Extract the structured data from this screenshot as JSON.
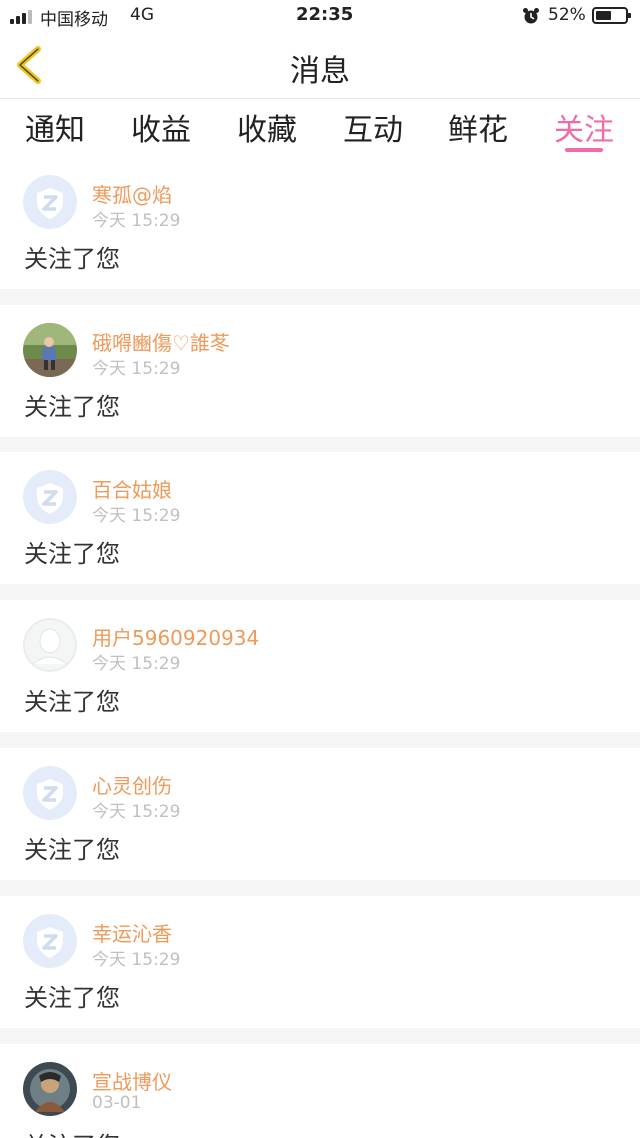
{
  "status_bar": {
    "carrier": "中国移动",
    "network": "4G",
    "time": "22:35",
    "battery_text": "52%",
    "battery_level": 0.52
  },
  "nav": {
    "title": "消息",
    "back_icon": "chevron-left-icon",
    "accent_color": "#f0c419"
  },
  "tabs": {
    "items": [
      {
        "label": "通知"
      },
      {
        "label": "收益"
      },
      {
        "label": "收藏"
      },
      {
        "label": "互动"
      },
      {
        "label": "鲜花"
      },
      {
        "label": "关注"
      }
    ],
    "active": "关注",
    "active_color": "#f06ba8"
  },
  "notifications": [
    {
      "username": "寒孤@焰",
      "time": "今天 15:29",
      "message": "关注了您",
      "avatar": "default-avatar"
    },
    {
      "username": "硪嘚豳傷♡誰苳",
      "time": "今天 15:29",
      "message": "关注了您",
      "avatar": "photo-avatar"
    },
    {
      "username": "百合姑娘",
      "time": "今天 15:29",
      "message": "关注了您",
      "avatar": "default-avatar"
    },
    {
      "username": "用户5960920934",
      "time": "今天 15:29",
      "message": "关注了您",
      "avatar": "silhouette-avatar"
    },
    {
      "username": "心灵创伤",
      "time": "今天 15:29",
      "message": "关注了您",
      "avatar": "default-avatar"
    },
    {
      "username": "幸运沁香",
      "time": "今天 15:29",
      "message": "关注了您",
      "avatar": "default-avatar"
    },
    {
      "username": "宣战博仪",
      "time": "03-01",
      "message": "关注了您",
      "avatar": "photo-avatar"
    }
  ],
  "colors": {
    "username": "#ef9a5a",
    "time": "#c0c0c0",
    "separator": "#f5f5f5"
  }
}
